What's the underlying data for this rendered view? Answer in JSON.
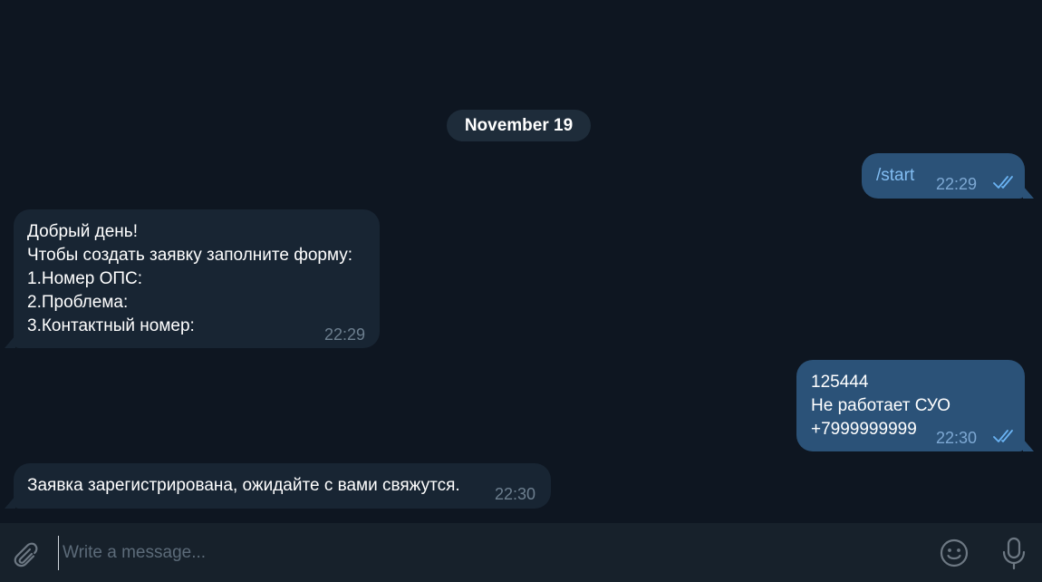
{
  "date_separator": "November 19",
  "messages": [
    {
      "direction": "out",
      "text_lines": [
        "/start"
      ],
      "time": "22:29",
      "read": true
    },
    {
      "direction": "in",
      "text_lines": [
        "Добрый день!",
        "Чтобы создать заявку заполните форму:",
        "1.Номер ОПС:",
        "2.Проблема:",
        "3.Контактный номер:"
      ],
      "time": "22:29"
    },
    {
      "direction": "out",
      "text_lines": [
        "125444",
        "Не работает СУО",
        "+7999999999"
      ],
      "time": "22:30",
      "read": true
    },
    {
      "direction": "in",
      "text_lines": [
        "Заявка зарегистрирована, ожидайте с вами свяжутся."
      ],
      "time": "22:30"
    }
  ],
  "composer": {
    "placeholder": "Write a message...",
    "value": ""
  },
  "icons": {
    "attach": "paperclip-icon",
    "emoji": "smiley-icon",
    "mic": "microphone-icon",
    "read_receipt": "double-check-icon"
  },
  "colors": {
    "background": "#0e1621",
    "incoming_bubble": "#182533",
    "outgoing_bubble": "#2b5278",
    "composer": "#17212b",
    "link": "#82bdf2",
    "read_check": "#6ab3f3"
  }
}
